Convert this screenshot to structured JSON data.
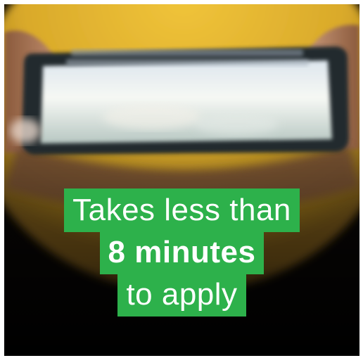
{
  "promo": {
    "line1": "Takes less than",
    "line2": "8 minutes",
    "line3": "to apply"
  },
  "colors": {
    "band": "#2db14b",
    "text": "#ffffff",
    "background": "#000000",
    "sweater": "#e2b52a"
  }
}
